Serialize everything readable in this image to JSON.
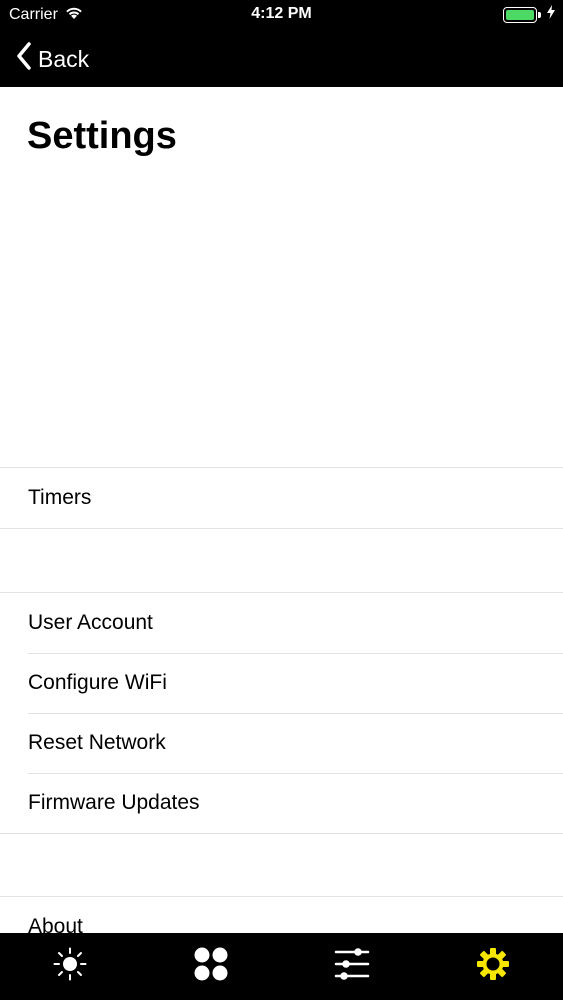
{
  "status_bar": {
    "carrier": "Carrier",
    "time": "4:12 PM"
  },
  "nav": {
    "back_label": "Back"
  },
  "page": {
    "title": "Settings"
  },
  "groups": [
    {
      "items": [
        {
          "label": "Timers"
        }
      ]
    },
    {
      "items": [
        {
          "label": "User Account"
        },
        {
          "label": "Configure WiFi"
        },
        {
          "label": "Reset Network"
        },
        {
          "label": "Firmware Updates"
        }
      ]
    },
    {
      "items": [
        {
          "label": "About"
        }
      ]
    }
  ],
  "tab_bar": {
    "tabs": [
      {
        "icon": "sun-icon"
      },
      {
        "icon": "dots-grid-icon"
      },
      {
        "icon": "sliders-icon"
      },
      {
        "icon": "gear-icon"
      }
    ],
    "active_index": 3
  },
  "colors": {
    "active_tab": "#f7e600",
    "battery": "#4cd964",
    "bar_background": "#000000"
  }
}
